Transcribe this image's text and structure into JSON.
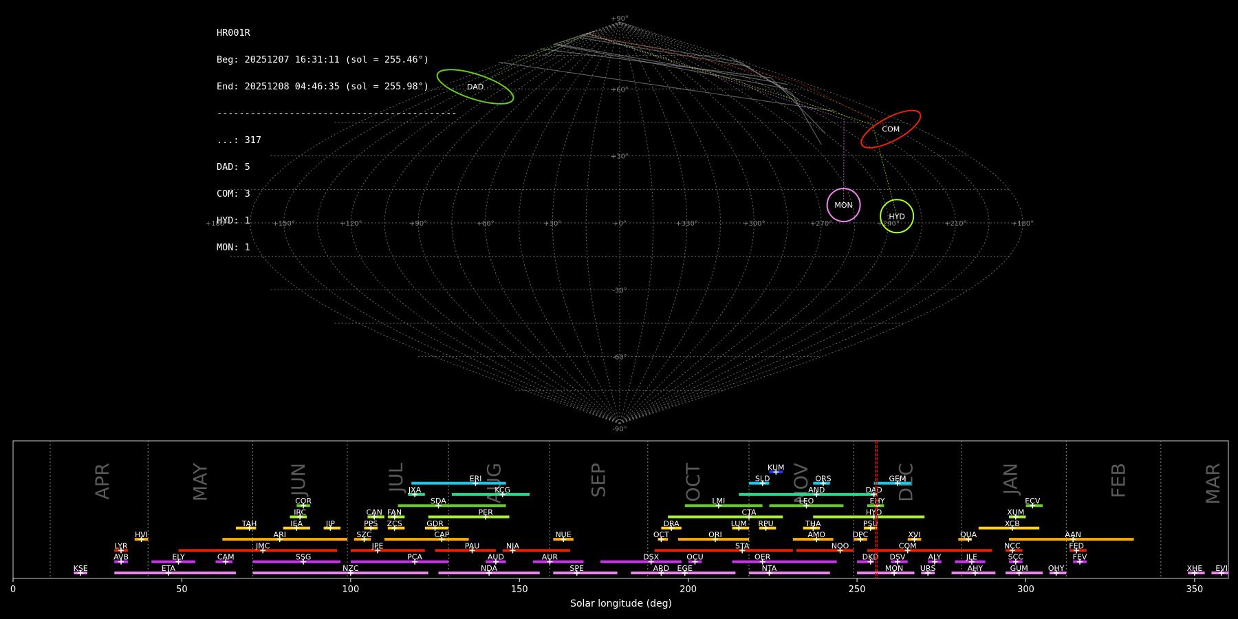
{
  "info": {
    "station": "HR001R",
    "begin": "Beg: 20251207 16:31:11 (sol = 255.46°)",
    "end": "End: 20251208 04:46:35 (sol = 255.98°)",
    "separator": "-------------------------------------------",
    "counts": [
      "...: 317",
      "DAD: 5",
      "COM: 3",
      "HYD: 1",
      "MON: 1"
    ]
  },
  "chart_data": [
    {
      "type": "scatter",
      "projection": "sinusoidal",
      "grid": true,
      "lat_labels": [
        "+90°",
        "+60°",
        "+30°",
        "-30°",
        "-60°",
        "-90°"
      ],
      "lon_labels": [
        "+180°",
        "+150°",
        "+120°",
        "+90°",
        "+60°",
        "+30°",
        "+0°",
        "+330°",
        "+300°",
        "+270°",
        "+240°",
        "+210°",
        "+180°"
      ],
      "radiants": [
        {
          "name": "DAD",
          "ra": 227,
          "dec": 61,
          "color": "#66cc22"
        },
        {
          "name": "COM",
          "ra": 163,
          "dec": 42,
          "color": "#ee2200"
        },
        {
          "name": "MON",
          "ra": 101,
          "dec": 8,
          "color": "#ee82ee"
        },
        {
          "name": "HYD",
          "ra": 124,
          "dec": 3,
          "color": "#aaff22"
        }
      ]
    },
    {
      "type": "timeline",
      "xlabel": "Solar longitude (deg)",
      "xlim": [
        0,
        360
      ],
      "xticks": [
        "0",
        "50",
        "100",
        "150",
        "200",
        "250",
        "300",
        "350"
      ],
      "current_sol": [
        255.46,
        255.98
      ],
      "month_labels": [
        {
          "name": "APR",
          "sol": 25
        },
        {
          "name": "MAY",
          "sol": 54
        },
        {
          "name": "JUN",
          "sol": 83
        },
        {
          "name": "JUL",
          "sol": 112
        },
        {
          "name": "AUG",
          "sol": 141
        },
        {
          "name": "SEP",
          "sol": 172
        },
        {
          "name": "OCT",
          "sol": 200
        },
        {
          "name": "NOV",
          "sol": 232
        },
        {
          "name": "DEC",
          "sol": 263
        },
        {
          "name": "JAN",
          "sol": 294
        },
        {
          "name": "FEB",
          "sol": 326
        },
        {
          "name": "MAR",
          "sol": 354
        }
      ],
      "month_dividers": [
        11,
        40,
        71,
        99,
        129,
        159,
        188,
        218,
        249,
        281,
        312,
        340
      ],
      "showers": [
        {
          "name": "KSE",
          "start": 18,
          "end": 22,
          "peak": 20,
          "row": 0,
          "color": "#ee82ee"
        },
        {
          "name": "ETA",
          "start": 30,
          "end": 66,
          "peak": 46,
          "row": 0,
          "color": "#ee82ee"
        },
        {
          "name": "NZC",
          "start": 71,
          "end": 123,
          "peak": 100,
          "row": 0,
          "color": "#ee82ee"
        },
        {
          "name": "NDA",
          "start": 126,
          "end": 156,
          "peak": 141,
          "row": 0,
          "color": "#ee82ee"
        },
        {
          "name": "SPE",
          "start": 160,
          "end": 179,
          "peak": 167,
          "row": 0,
          "color": "#ee82ee"
        },
        {
          "name": "ARD",
          "start": 183,
          "end": 196,
          "peak": 192,
          "row": 0,
          "color": "#ee82ee"
        },
        {
          "name": "EGE",
          "start": 196,
          "end": 214,
          "peak": 199,
          "row": 0,
          "color": "#ee82ee"
        },
        {
          "name": "NTA",
          "start": 218,
          "end": 242,
          "peak": 224,
          "row": 0,
          "color": "#ee82ee"
        },
        {
          "name": "MON",
          "start": 250,
          "end": 267,
          "peak": 261,
          "row": 0,
          "color": "#ee82ee"
        },
        {
          "name": "URS",
          "start": 269,
          "end": 273,
          "peak": 271,
          "row": 0,
          "color": "#ee82ee"
        },
        {
          "name": "AHY",
          "start": 278,
          "end": 291,
          "peak": 285,
          "row": 0,
          "color": "#ee82ee"
        },
        {
          "name": "GUM",
          "start": 294,
          "end": 305,
          "peak": 298,
          "row": 0,
          "color": "#ee82ee"
        },
        {
          "name": "OHY",
          "start": 307,
          "end": 312,
          "peak": 309,
          "row": 0,
          "color": "#ee82ee"
        },
        {
          "name": "XHE",
          "start": 348,
          "end": 353,
          "peak": 350,
          "row": 0,
          "color": "#ee82ee"
        },
        {
          "name": "EVI",
          "start": 355,
          "end": 360,
          "peak": 358,
          "row": 0,
          "color": "#ee82ee"
        },
        {
          "name": "AVB",
          "start": 30,
          "end": 34,
          "peak": 32,
          "row": 1,
          "color": "#cc33ee"
        },
        {
          "name": "ELY",
          "start": 41,
          "end": 54,
          "peak": 49,
          "row": 1,
          "color": "#cc33ee"
        },
        {
          "name": "CAM",
          "start": 60,
          "end": 65,
          "peak": 63,
          "row": 1,
          "color": "#cc33ee"
        },
        {
          "name": "SSG",
          "start": 71,
          "end": 97,
          "peak": 86,
          "row": 1,
          "color": "#cc33ee"
        },
        {
          "name": "PCA",
          "start": 100,
          "end": 129,
          "peak": 119,
          "row": 1,
          "color": "#cc33ee"
        },
        {
          "name": "AUD",
          "start": 140,
          "end": 146,
          "peak": 143,
          "row": 1,
          "color": "#cc33ee"
        },
        {
          "name": "AUR",
          "start": 154,
          "end": 169,
          "peak": 159,
          "row": 1,
          "color": "#cc33ee"
        },
        {
          "name": "DSX",
          "start": 174,
          "end": 198,
          "peak": 189,
          "row": 1,
          "color": "#cc33ee"
        },
        {
          "name": "OCU",
          "start": 200,
          "end": 204,
          "peak": 202,
          "row": 1,
          "color": "#cc33ee"
        },
        {
          "name": "OER",
          "start": 213,
          "end": 244,
          "peak": 222,
          "row": 1,
          "color": "#cc33ee"
        },
        {
          "name": "DKD",
          "start": 250,
          "end": 255,
          "peak": 254,
          "row": 1,
          "color": "#cc33ee"
        },
        {
          "name": "DSV",
          "start": 260,
          "end": 265,
          "peak": 262,
          "row": 1,
          "color": "#cc33ee"
        },
        {
          "name": "ALY",
          "start": 271,
          "end": 275,
          "peak": 273,
          "row": 1,
          "color": "#cc33ee"
        },
        {
          "name": "JLE",
          "start": 279,
          "end": 288,
          "peak": 284,
          "row": 1,
          "color": "#cc33ee"
        },
        {
          "name": "SCC",
          "start": 295,
          "end": 299,
          "peak": 297,
          "row": 1,
          "color": "#cc33ee"
        },
        {
          "name": "FEV",
          "start": 314,
          "end": 318,
          "peak": 316,
          "row": 1,
          "color": "#cc33ee"
        },
        {
          "name": "LYR",
          "start": 30,
          "end": 34,
          "peak": 32,
          "row": 2,
          "color": "#ee2200"
        },
        {
          "name": "JMC",
          "start": 49,
          "end": 96,
          "peak": 74,
          "row": 2,
          "color": "#ee2200"
        },
        {
          "name": "JPE",
          "start": 100,
          "end": 122,
          "peak": 108,
          "row": 2,
          "color": "#ee2200"
        },
        {
          "name": "PAU",
          "start": 125,
          "end": 143,
          "peak": 136,
          "row": 2,
          "color": "#ee2200"
        },
        {
          "name": "NIA",
          "start": 145,
          "end": 165,
          "peak": 148,
          "row": 2,
          "color": "#ee2200"
        },
        {
          "name": "STA",
          "start": 190,
          "end": 231,
          "peak": 216,
          "row": 2,
          "color": "#ee2200"
        },
        {
          "name": "NOO",
          "start": 232,
          "end": 249,
          "peak": 245,
          "row": 2,
          "color": "#ee2200"
        },
        {
          "name": "COM",
          "start": 253,
          "end": 290,
          "peak": 265,
          "row": 2,
          "color": "#ee2200"
        },
        {
          "name": "NCC",
          "start": 294,
          "end": 299,
          "peak": 296,
          "row": 2,
          "color": "#ee2200"
        },
        {
          "name": "FED",
          "start": 313,
          "end": 318,
          "peak": 315,
          "row": 2,
          "color": "#ee2200"
        },
        {
          "name": "HVI",
          "start": 36,
          "end": 40,
          "peak": 38,
          "row": 3,
          "color": "#ffaa11"
        },
        {
          "name": "ARI",
          "start": 62,
          "end": 99,
          "peak": 79,
          "row": 3,
          "color": "#ffaa11"
        },
        {
          "name": "SZC",
          "start": 101,
          "end": 106,
          "peak": 104,
          "row": 3,
          "color": "#ffaa11"
        },
        {
          "name": "CAP",
          "start": 110,
          "end": 135,
          "peak": 127,
          "row": 3,
          "color": "#ffaa11"
        },
        {
          "name": "NUE",
          "start": 160,
          "end": 166,
          "peak": 163,
          "row": 3,
          "color": "#ffaa11"
        },
        {
          "name": "OCT",
          "start": 191,
          "end": 194,
          "peak": 192,
          "row": 3,
          "color": "#ffaa11"
        },
        {
          "name": "ORI",
          "start": 197,
          "end": 218,
          "peak": 208,
          "row": 3,
          "color": "#ffaa11"
        },
        {
          "name": "AMO",
          "start": 231,
          "end": 243,
          "peak": 238,
          "row": 3,
          "color": "#ffaa11"
        },
        {
          "name": "DPC",
          "start": 249,
          "end": 253,
          "peak": 251,
          "row": 3,
          "color": "#ffaa11"
        },
        {
          "name": "XVI",
          "start": 265,
          "end": 269,
          "peak": 267,
          "row": 3,
          "color": "#ffaa11"
        },
        {
          "name": "QUA",
          "start": 280,
          "end": 284,
          "peak": 283,
          "row": 3,
          "color": "#ffaa11"
        },
        {
          "name": "AAN",
          "start": 295,
          "end": 332,
          "peak": 314,
          "row": 3,
          "color": "#ffaa11"
        },
        {
          "name": "TAH",
          "start": 66,
          "end": 72,
          "peak": 70,
          "row": 4,
          "color": "#ffd21e"
        },
        {
          "name": "IEA",
          "start": 80,
          "end": 88,
          "peak": 84,
          "row": 4,
          "color": "#ffd21e"
        },
        {
          "name": "JIP",
          "start": 92,
          "end": 97,
          "peak": 94,
          "row": 4,
          "color": "#ffd21e"
        },
        {
          "name": "PPS",
          "start": 104,
          "end": 108,
          "peak": 106,
          "row": 4,
          "color": "#ffd21e"
        },
        {
          "name": "ZCS",
          "start": 111,
          "end": 116,
          "peak": 113,
          "row": 4,
          "color": "#ffd21e"
        },
        {
          "name": "GDR",
          "start": 122,
          "end": 129,
          "peak": 125,
          "row": 4,
          "color": "#ffd21e"
        },
        {
          "name": "DRA",
          "start": 192,
          "end": 198,
          "peak": 195,
          "row": 4,
          "color": "#ffd21e"
        },
        {
          "name": "LUM",
          "start": 213,
          "end": 218,
          "peak": 215,
          "row": 4,
          "color": "#ffd21e"
        },
        {
          "name": "RPU",
          "start": 221,
          "end": 226,
          "peak": 223,
          "row": 4,
          "color": "#ffd21e"
        },
        {
          "name": "THA",
          "start": 234,
          "end": 239,
          "peak": 237,
          "row": 4,
          "color": "#ffd21e"
        },
        {
          "name": "PSU",
          "start": 252,
          "end": 256,
          "peak": 254,
          "row": 4,
          "color": "#ffd21e"
        },
        {
          "name": "XCB",
          "start": 286,
          "end": 304,
          "peak": 296,
          "row": 4,
          "color": "#ffd21e"
        },
        {
          "name": "IRC",
          "start": 82,
          "end": 87,
          "peak": 85,
          "row": 5,
          "color": "#aaee33"
        },
        {
          "name": "CAN",
          "start": 105,
          "end": 110,
          "peak": 107,
          "row": 5,
          "color": "#aaee33"
        },
        {
          "name": "FAN",
          "start": 111,
          "end": 116,
          "peak": 113,
          "row": 5,
          "color": "#aaee33"
        },
        {
          "name": "PER",
          "start": 123,
          "end": 147,
          "peak": 140,
          "row": 5,
          "color": "#aaee33"
        },
        {
          "name": "CTA",
          "start": 194,
          "end": 228,
          "peak": 218,
          "row": 5,
          "color": "#aaee33"
        },
        {
          "name": "HYD",
          "start": 237,
          "end": 270,
          "peak": 255,
          "row": 5,
          "color": "#aaee33"
        },
        {
          "name": "XUM",
          "start": 295,
          "end": 300,
          "peak": 297,
          "row": 5,
          "color": "#aaee33"
        },
        {
          "name": "COR",
          "start": 84,
          "end": 88,
          "peak": 86,
          "row": 6,
          "color": "#66cc22"
        },
        {
          "name": "SDA",
          "start": 114,
          "end": 146,
          "peak": 126,
          "row": 6,
          "color": "#66cc22"
        },
        {
          "name": "LMI",
          "start": 199,
          "end": 222,
          "peak": 209,
          "row": 6,
          "color": "#66cc22"
        },
        {
          "name": "LEO",
          "start": 224,
          "end": 246,
          "peak": 235,
          "row": 6,
          "color": "#66cc22"
        },
        {
          "name": "EHY",
          "start": 253,
          "end": 258,
          "peak": 256,
          "row": 6,
          "color": "#66cc22"
        },
        {
          "name": "ECV",
          "start": 300,
          "end": 305,
          "peak": 302,
          "row": 6,
          "color": "#66cc22"
        },
        {
          "name": "JXA",
          "start": 117,
          "end": 122,
          "peak": 119,
          "row": 7,
          "color": "#22dd88"
        },
        {
          "name": "KCG",
          "start": 130,
          "end": 153,
          "peak": 145,
          "row": 7,
          "color": "#22dd88"
        },
        {
          "name": "AND",
          "start": 215,
          "end": 250,
          "peak": 238,
          "row": 7,
          "color": "#22dd88"
        },
        {
          "name": "DAD",
          "start": 249,
          "end": 256,
          "peak": 255,
          "row": 7,
          "color": "#22dd88"
        },
        {
          "name": "ERI",
          "start": 118,
          "end": 146,
          "peak": 137,
          "row": 8,
          "color": "#11ccee"
        },
        {
          "name": "SLD",
          "start": 218,
          "end": 224,
          "peak": 222,
          "row": 8,
          "color": "#11ccee"
        },
        {
          "name": "ORS",
          "start": 237,
          "end": 242,
          "peak": 240,
          "row": 8,
          "color": "#11ccee"
        },
        {
          "name": "GEM",
          "start": 255,
          "end": 266,
          "peak": 262,
          "row": 8,
          "color": "#11ccee"
        },
        {
          "name": "KUM",
          "start": 224,
          "end": 228,
          "peak": 226,
          "row": 9,
          "color": "#2233ee"
        }
      ]
    }
  ]
}
